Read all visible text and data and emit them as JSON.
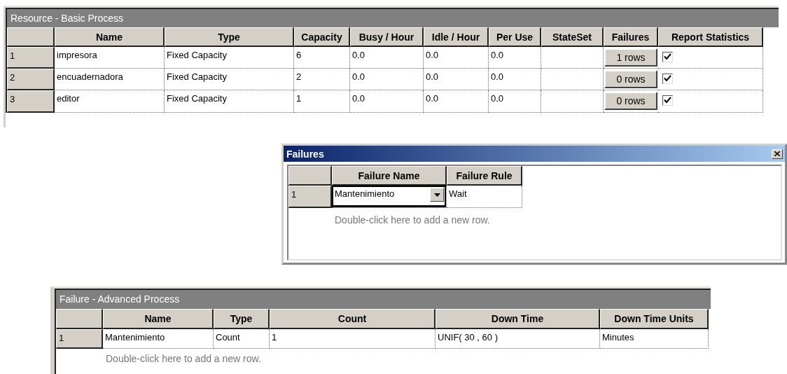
{
  "panels": [
    {
      "kind": "grid",
      "title": "Resource - Basic Process",
      "columns": [
        "Name",
        "Type",
        "Capacity",
        "Busy / Hour",
        "Idle / Hour",
        "Per Use",
        "StateSet",
        "Failures",
        "Report Statistics"
      ],
      "rows": [
        {
          "number": "1",
          "cells": [
            {
              "kind": "text",
              "text": "impresora"
            },
            {
              "kind": "text",
              "text": "Fixed Capacity"
            },
            {
              "kind": "text",
              "text": "6"
            },
            {
              "kind": "text",
              "text": "0.0"
            },
            {
              "kind": "text",
              "text": "0.0"
            },
            {
              "kind": "text",
              "text": "0.0"
            },
            {
              "kind": "blank"
            },
            {
              "kind": "button",
              "text": "1 rows"
            },
            {
              "kind": "checkbox",
              "checked": true
            }
          ]
        },
        {
          "number": "2",
          "cells": [
            {
              "kind": "text",
              "text": "encuadernadora"
            },
            {
              "kind": "text",
              "text": "Fixed Capacity"
            },
            {
              "kind": "text",
              "text": "2"
            },
            {
              "kind": "text",
              "text": "0.0"
            },
            {
              "kind": "text",
              "text": "0.0"
            },
            {
              "kind": "text",
              "text": "0.0"
            },
            {
              "kind": "blank"
            },
            {
              "kind": "button",
              "text": "0 rows"
            },
            {
              "kind": "checkbox",
              "checked": true
            }
          ]
        },
        {
          "number": "3",
          "cells": [
            {
              "kind": "text",
              "text": "editor"
            },
            {
              "kind": "text",
              "text": "Fixed Capacity"
            },
            {
              "kind": "text",
              "text": "1"
            },
            {
              "kind": "text",
              "text": "0.0"
            },
            {
              "kind": "text",
              "text": "0.0"
            },
            {
              "kind": "text",
              "text": "0.0"
            },
            {
              "kind": "blank"
            },
            {
              "kind": "button",
              "text": "0 rows"
            },
            {
              "kind": "checkbox",
              "checked": true
            }
          ]
        }
      ]
    },
    {
      "kind": "dialog",
      "title": "Failures",
      "columns": [
        "Failure Name",
        "Failure Rule"
      ],
      "rows": [
        {
          "number": "1",
          "cells": [
            {
              "kind": "dropdown",
              "text": "Mantenimiento"
            },
            {
              "kind": "text",
              "text": "Wait"
            }
          ]
        }
      ],
      "add_row_hint": "Double-click here to add a new row."
    },
    {
      "kind": "grid",
      "title": "Failure - Advanced Process",
      "columns": [
        "Name",
        "Type",
        "Count",
        "Down Time",
        "Down Time Units"
      ],
      "rows": [
        {
          "number": "1",
          "cells": [
            {
              "kind": "text",
              "text": "Mantenimiento"
            },
            {
              "kind": "text",
              "text": "Count"
            },
            {
              "kind": "text",
              "text": "1"
            },
            {
              "kind": "text",
              "text": "UNIF( 30 , 60 )"
            },
            {
              "kind": "text",
              "text": "Minutes"
            }
          ]
        }
      ],
      "add_row_hint": "Double-click here to add a new row."
    }
  ]
}
